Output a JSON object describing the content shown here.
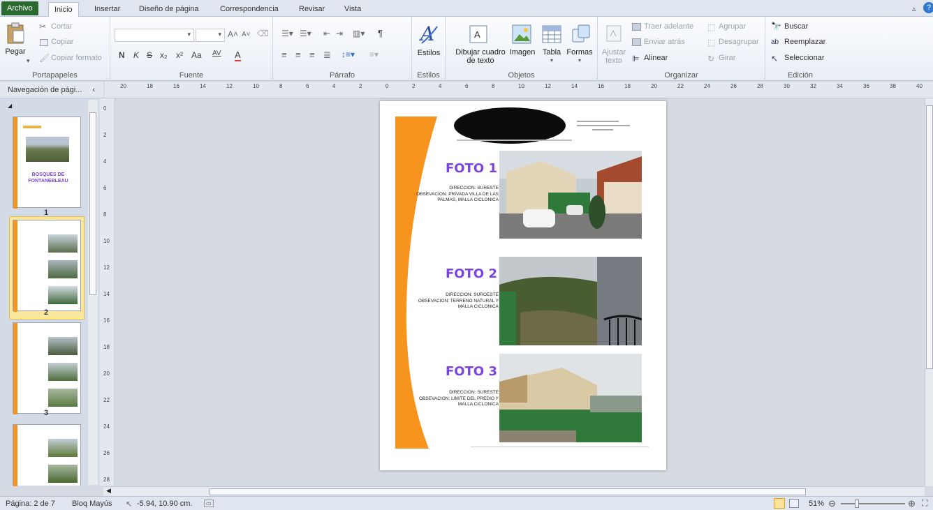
{
  "tabs": [
    "Archivo",
    "Inicio",
    "Insertar",
    "Diseño de página",
    "Correspondencia",
    "Revisar",
    "Vista"
  ],
  "ribbon": {
    "clipboard": {
      "paste": "Pegar",
      "cut": "Cortar",
      "copy": "Copiar",
      "format_painter": "Copiar formato",
      "label": "Portapapeles"
    },
    "font": {
      "label": "Fuente",
      "bold": "N",
      "italic": "K",
      "strike": "S",
      "sub": "x₂",
      "sup": "x²",
      "case": "Aa",
      "spacing": "AV",
      "color": "A"
    },
    "paragraph": {
      "label": "Párrafo",
      "pilcrow": "¶"
    },
    "styles": {
      "button": "Estilos",
      "label": "Estilos"
    },
    "objects": {
      "textbox_line1": "Dibujar cuadro",
      "textbox_line2": "de texto",
      "image": "Imagen",
      "table": "Tabla",
      "shapes": "Formas",
      "label": "Objetos"
    },
    "arrange": {
      "wrap_line1": "Ajustar",
      "wrap_line2": "texto",
      "bring_forward": "Traer adelante",
      "send_backward": "Enviar atrás",
      "align": "Alinear",
      "group": "Agrupar",
      "ungroup": "Desagrupar",
      "rotate": "Girar",
      "label": "Organizar"
    },
    "editing": {
      "find": "Buscar",
      "replace": "Reemplazar",
      "select": "Seleccionar",
      "label": "Edición"
    }
  },
  "nav": {
    "title": "Navegación de pági...",
    "pages": [
      "1",
      "2",
      "3"
    ],
    "cover_title": "BOSQUES DE FONTANEBLEAU"
  },
  "ruler_h": [
    "20",
    "18",
    "16",
    "14",
    "12",
    "10",
    "8",
    "6",
    "4",
    "2",
    "0",
    "2",
    "4",
    "6",
    "8",
    "10",
    "12",
    "14",
    "16",
    "18",
    "20",
    "22",
    "24",
    "26",
    "28",
    "30",
    "32",
    "34",
    "36",
    "38",
    "40"
  ],
  "ruler_v": [
    "0",
    "2",
    "4",
    "6",
    "8",
    "10",
    "12",
    "14",
    "16",
    "18",
    "20",
    "22",
    "24",
    "26",
    "28"
  ],
  "document": {
    "photos": [
      {
        "title": "FOTO 1",
        "direction": "DIRECCION: SURESTE",
        "observation": "OBSEVACION: PRIVADA VILLA DE LAS PALMAS, MALLA CICLONICA"
      },
      {
        "title": "FOTO 2",
        "direction": "DIRECCION: SUROESTE",
        "observation": "OBSEVACION: TERRENO NATURAL Y MALLA CICLONICA"
      },
      {
        "title": "FOTO 3",
        "direction": "DIRECCION: SURESTE",
        "observation": "OBSEVACION: LIMITE DEL PREDIO Y MALLA CICLONICA"
      }
    ]
  },
  "status": {
    "page": "Página: 2 de 7",
    "caps": "Bloq Mayús",
    "coords": "-5.94, 10.90 cm.",
    "zoom": "51%"
  },
  "colors": {
    "accent_orange": "#f7941d",
    "foto_purple": "#7a44e0",
    "file_tab": "#2b6a2f"
  }
}
